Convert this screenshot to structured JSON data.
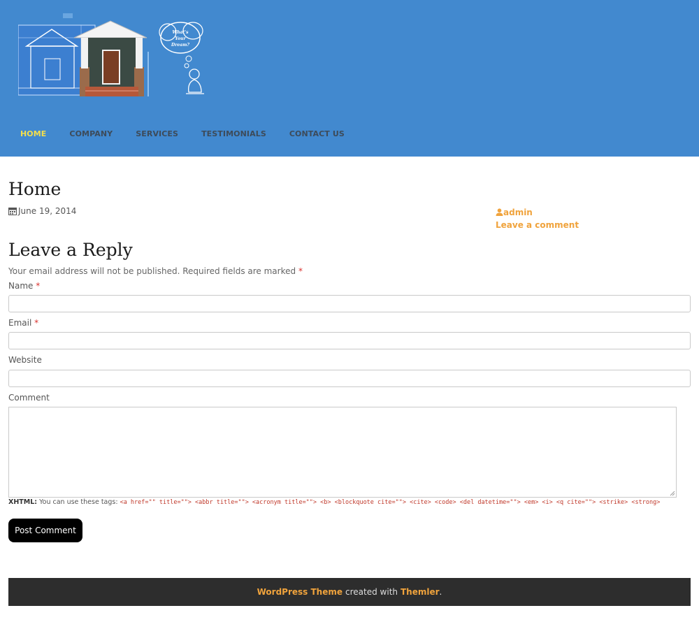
{
  "header": {
    "logo_tagline": "What's Your Dream?",
    "nav": [
      {
        "label": "HOME",
        "active": true
      },
      {
        "label": "COMPANY"
      },
      {
        "label": "SERVICES"
      },
      {
        "label": "TESTIMONIALS"
      },
      {
        "label": "CONTACT US"
      }
    ]
  },
  "post": {
    "title": "Home",
    "date": "June 19, 2014",
    "author": "admin",
    "comment_link": "Leave a comment"
  },
  "reply": {
    "title": "Leave a Reply",
    "notes": "Your email address will not be published. Required fields are marked",
    "required_mark": "*",
    "fields": {
      "name_label": "Name",
      "email_label": "Email",
      "website_label": "Website",
      "comment_label": "Comment"
    },
    "allowed_tags_label": "XHTML:",
    "allowed_tags_text": "You can use these tags:",
    "allowed_tags": "<a href=\"\" title=\"\"> <abbr title=\"\"> <acronym title=\"\"> <b> <blockquote cite=\"\"> <cite> <code> <del datetime=\"\"> <em> <i> <q cite=\"\"> <strike> <strong>",
    "submit_label": "Post Comment"
  },
  "footer": {
    "theme_link": "WordPress Theme",
    "middle": "created with",
    "themler_link": "Themler",
    "end": "."
  },
  "colors": {
    "header_bg": "#4289cf",
    "nav_active": "#f3df4c",
    "accent": "#f0a33c",
    "footer_bg": "#2d2d2d"
  }
}
